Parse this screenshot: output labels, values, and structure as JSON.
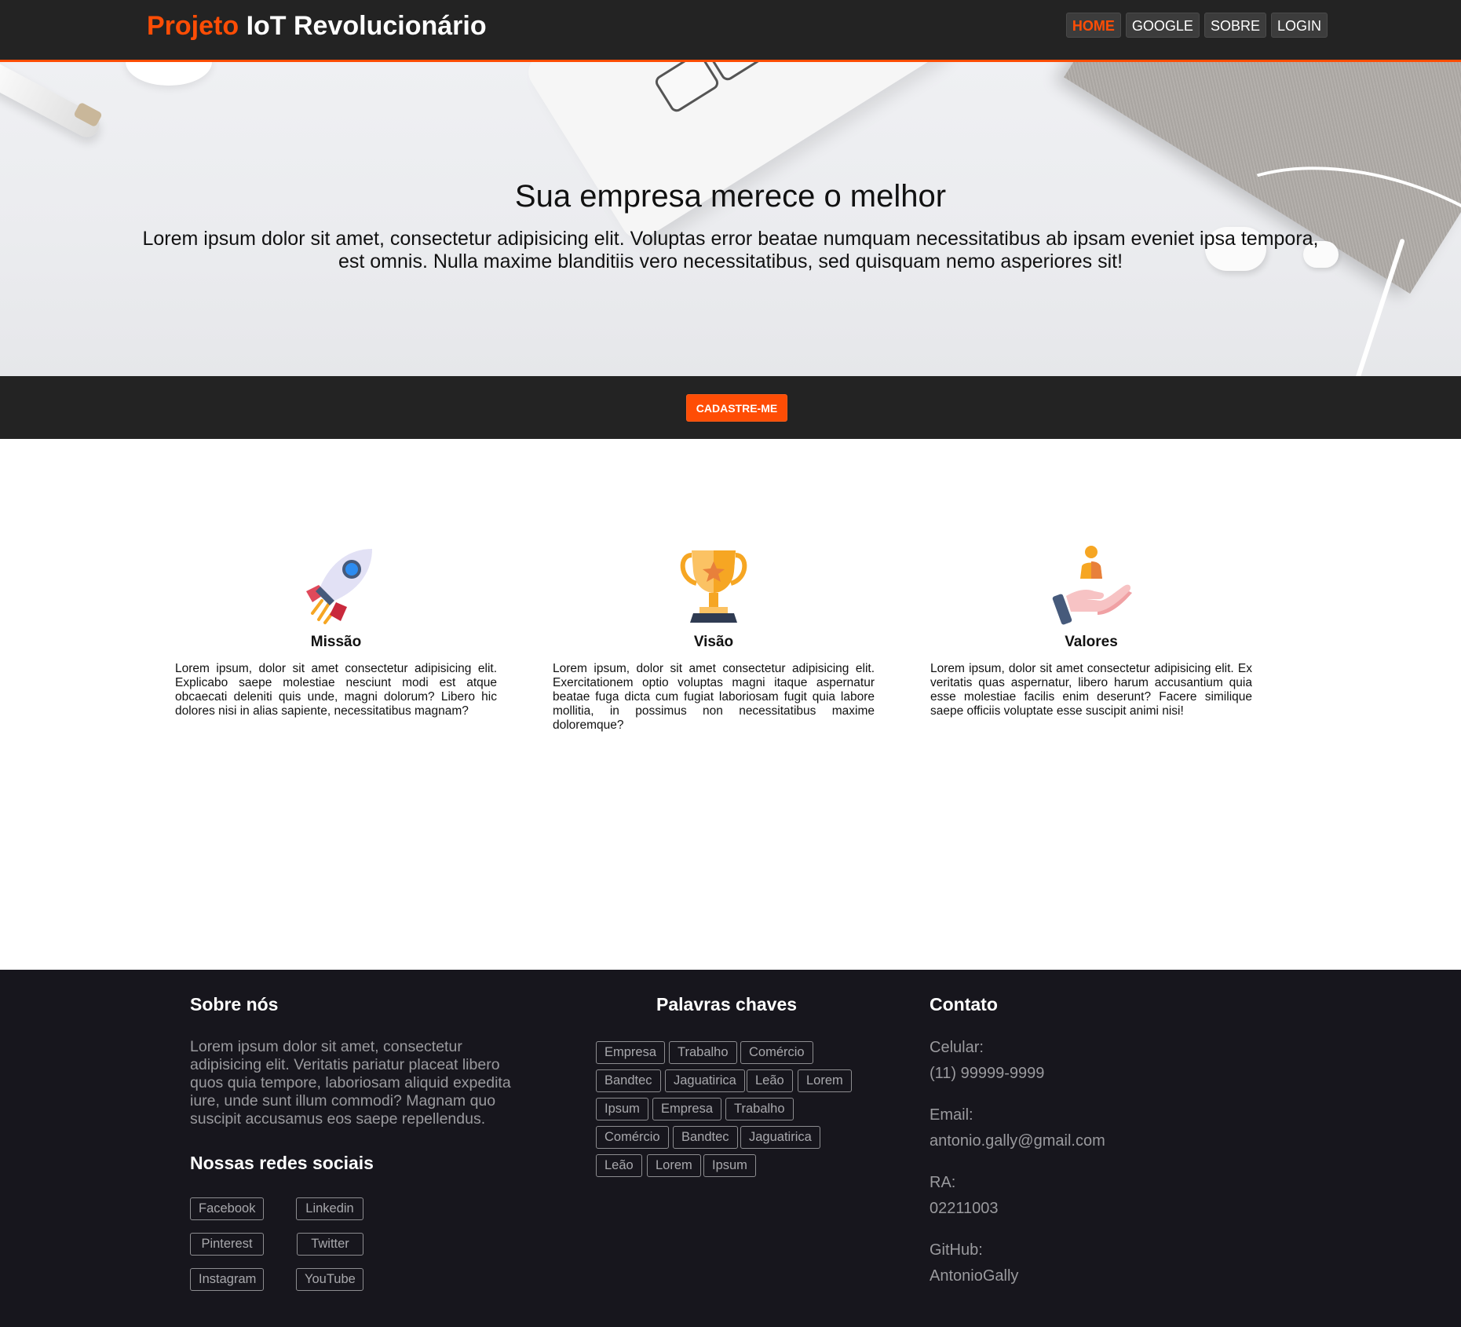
{
  "header": {
    "brand_accent": "Projeto",
    "brand_rest": "IoT Revolucionário",
    "accent_color": "#ff4d05",
    "nav": [
      {
        "label": "HOME",
        "active": true
      },
      {
        "label": "GOOGLE",
        "active": false
      },
      {
        "label": "SOBRE",
        "active": false
      },
      {
        "label": "LOGIN",
        "active": false
      }
    ]
  },
  "hero": {
    "title": "Sua empresa merece o melhor",
    "text": "Lorem ipsum dolor sit amet, consectetur adipisicing elit. Voluptas error beatae numquam necessitatibus ab ipsam eveniet ipsa tempora, est omnis. Nulla maxime blanditiis vero necessitatibus, sed quisquam nemo asperiores sit!"
  },
  "cta": {
    "label": "CADASTRE-ME"
  },
  "features": [
    {
      "icon": "rocket-icon",
      "title": "Missão",
      "text": "Lorem ipsum, dolor sit amet consectetur adipisicing elit. Explicabo saepe molestiae nesciunt modi est atque obcaecati deleniti quis unde, magni dolorum? Libero hic dolores nisi in alias sapiente, necessitatibus magnam?"
    },
    {
      "icon": "trophy-icon",
      "title": "Visão",
      "text": "Lorem ipsum, dolor sit amet consectetur adipisicing elit. Exercitationem optio voluptas magni itaque aspernatur beatae fuga dicta cum fugiat laboriosam fugit quia labore mollitia, in possimus non necessitatibus maxime doloremque?"
    },
    {
      "icon": "hand-person-icon",
      "title": "Valores",
      "text": "Lorem ipsum, dolor sit amet consectetur adipisicing elit. Ex veritatis quas aspernatur, libero harum accusantium quia esse molestiae facilis enim deserunt? Facere similique saepe officiis voluptate esse suscipit animi nisi!"
    }
  ],
  "footer": {
    "about_title": "Sobre nós",
    "about_text": "Lorem ipsum dolor sit amet, consectetur adipisicing elit. Veritatis pariatur placeat libero quos quia tempore, laboriosam aliquid expedita iure, unde sunt illum commodi? Magnam quo suscipit accusamus eos saepe repellendus.",
    "social_title": "Nossas redes sociais",
    "social": [
      "Facebook",
      "Linkedin",
      "Pinterest",
      "Twitter",
      "Instagram",
      "YouTube"
    ],
    "keywords_title": "Palavras chaves",
    "keywords": [
      "Empresa",
      "Trabalho",
      "Comércio",
      "Bandtec",
      "Jaguatirica",
      "Leão",
      "Lorem",
      "Ipsum",
      "Empresa",
      "Trabalho",
      "Comércio",
      "Bandtec",
      "Jaguatirica",
      "Leão",
      "Lorem",
      "Ipsum"
    ],
    "contact_title": "Contato",
    "contact": [
      {
        "label": "Celular:",
        "value": "(11) 99999-9999"
      },
      {
        "label": "Email:",
        "value": "antonio.gally@gmail.com"
      },
      {
        "label": "RA:",
        "value": "02211003"
      },
      {
        "label": "GitHub:",
        "value": "AntonioGally"
      }
    ]
  }
}
